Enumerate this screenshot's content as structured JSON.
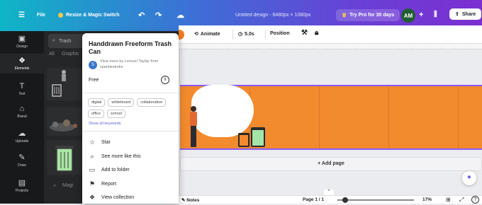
{
  "topbar": {
    "menu_icon": "hamburger-icon",
    "file": "File",
    "resize": "Resize & Magic Switch",
    "title": "Untitled design - 6480px × 1080px",
    "pro": "Try Pro for 30 days",
    "avatar": "AM",
    "share": "Share"
  },
  "rail": [
    {
      "label": "Design",
      "icon": "design-icon"
    },
    {
      "label": "Elements",
      "icon": "elements-icon"
    },
    {
      "label": "Text",
      "icon": "text-icon"
    },
    {
      "label": "Brand",
      "icon": "brand-icon"
    },
    {
      "label": "Uploads",
      "icon": "uploads-icon"
    },
    {
      "label": "Draw",
      "icon": "draw-icon"
    },
    {
      "label": "Projects",
      "icon": "projects-icon"
    }
  ],
  "panel": {
    "search_value": "Trash",
    "tab_all": "All",
    "tab_graphics": "Graphic",
    "magic_label": "Magi"
  },
  "popup": {
    "title": "Handdrawn Freeform Trash Can",
    "creator_initial": "S",
    "creator_text": "View more by Lemuel Taylay from sparklestroke",
    "price": "Free",
    "tags": [
      "digital",
      "whiteboard",
      "collaboration",
      "office",
      "school"
    ],
    "keywords_link": "Show all keywords",
    "menu": [
      "Star",
      "See more like this",
      "Add to folder",
      "Report",
      "View collection"
    ]
  },
  "toolbar": {
    "animate": "Animate",
    "duration": "5.0s",
    "position": "Position"
  },
  "canvas": {
    "add_page": "+ Add page"
  },
  "bottom": {
    "notes": "Notes",
    "page": "Page 1 / 1",
    "zoom": "17%"
  }
}
